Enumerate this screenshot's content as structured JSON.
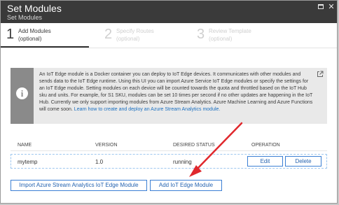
{
  "window": {
    "title": "Set Modules",
    "subtitle": "Set Modules",
    "maximize_icon": "maximize-icon",
    "close_icon": "close-icon",
    "close_glyph": "✕"
  },
  "steps": [
    {
      "number": "1",
      "label": "Add Modules",
      "sublabel": "(optional)",
      "active": true
    },
    {
      "number": "2",
      "label": "Specify Routes",
      "sublabel": "(optional)",
      "active": false
    },
    {
      "number": "3",
      "label": "Review Template",
      "sublabel": "(optional)",
      "active": false
    }
  ],
  "info": {
    "icon": "info-icon",
    "icon_glyph": "i",
    "text": "An IoT Edge module is a Docker container you can deploy to IoT Edge devices. It communicates with other modules and sends data to the IoT Edge runtime. Using this UI you can import Azure Service IoT Edge modules or specify the settings for an IoT Edge module. Setting modules on each device will be counted towards the quota and throttled based on the IoT Hub sku and units. For example, for S1 SKU, modules can be set 10 times per second if no other updates are happening in the IoT Hub. Currently we only support importing modules from Azure Stream Analytics. Azure Machine Learning and Azure Functions will come soon. ",
    "link_text": "Learn how to create and deploy an Azure Stream Analytics module.",
    "external_icon": "external-link-icon"
  },
  "table": {
    "columns": [
      "NAME",
      "VERSION",
      "DESIRED STATUS",
      "OPERATION"
    ],
    "rows": [
      {
        "name": "mytemp",
        "version": "1.0",
        "status": "running",
        "edit_label": "Edit",
        "delete_label": "Delete"
      }
    ]
  },
  "buttons": {
    "import_label": "Import Azure Stream Analytics IoT Edge Module",
    "add_label": "Add IoT Edge Module"
  },
  "colors": {
    "titlebar": "#3a3a3a",
    "accent": "#3b7fd4",
    "link": "#1a6fc0",
    "annotation_arrow": "#e0282d"
  }
}
